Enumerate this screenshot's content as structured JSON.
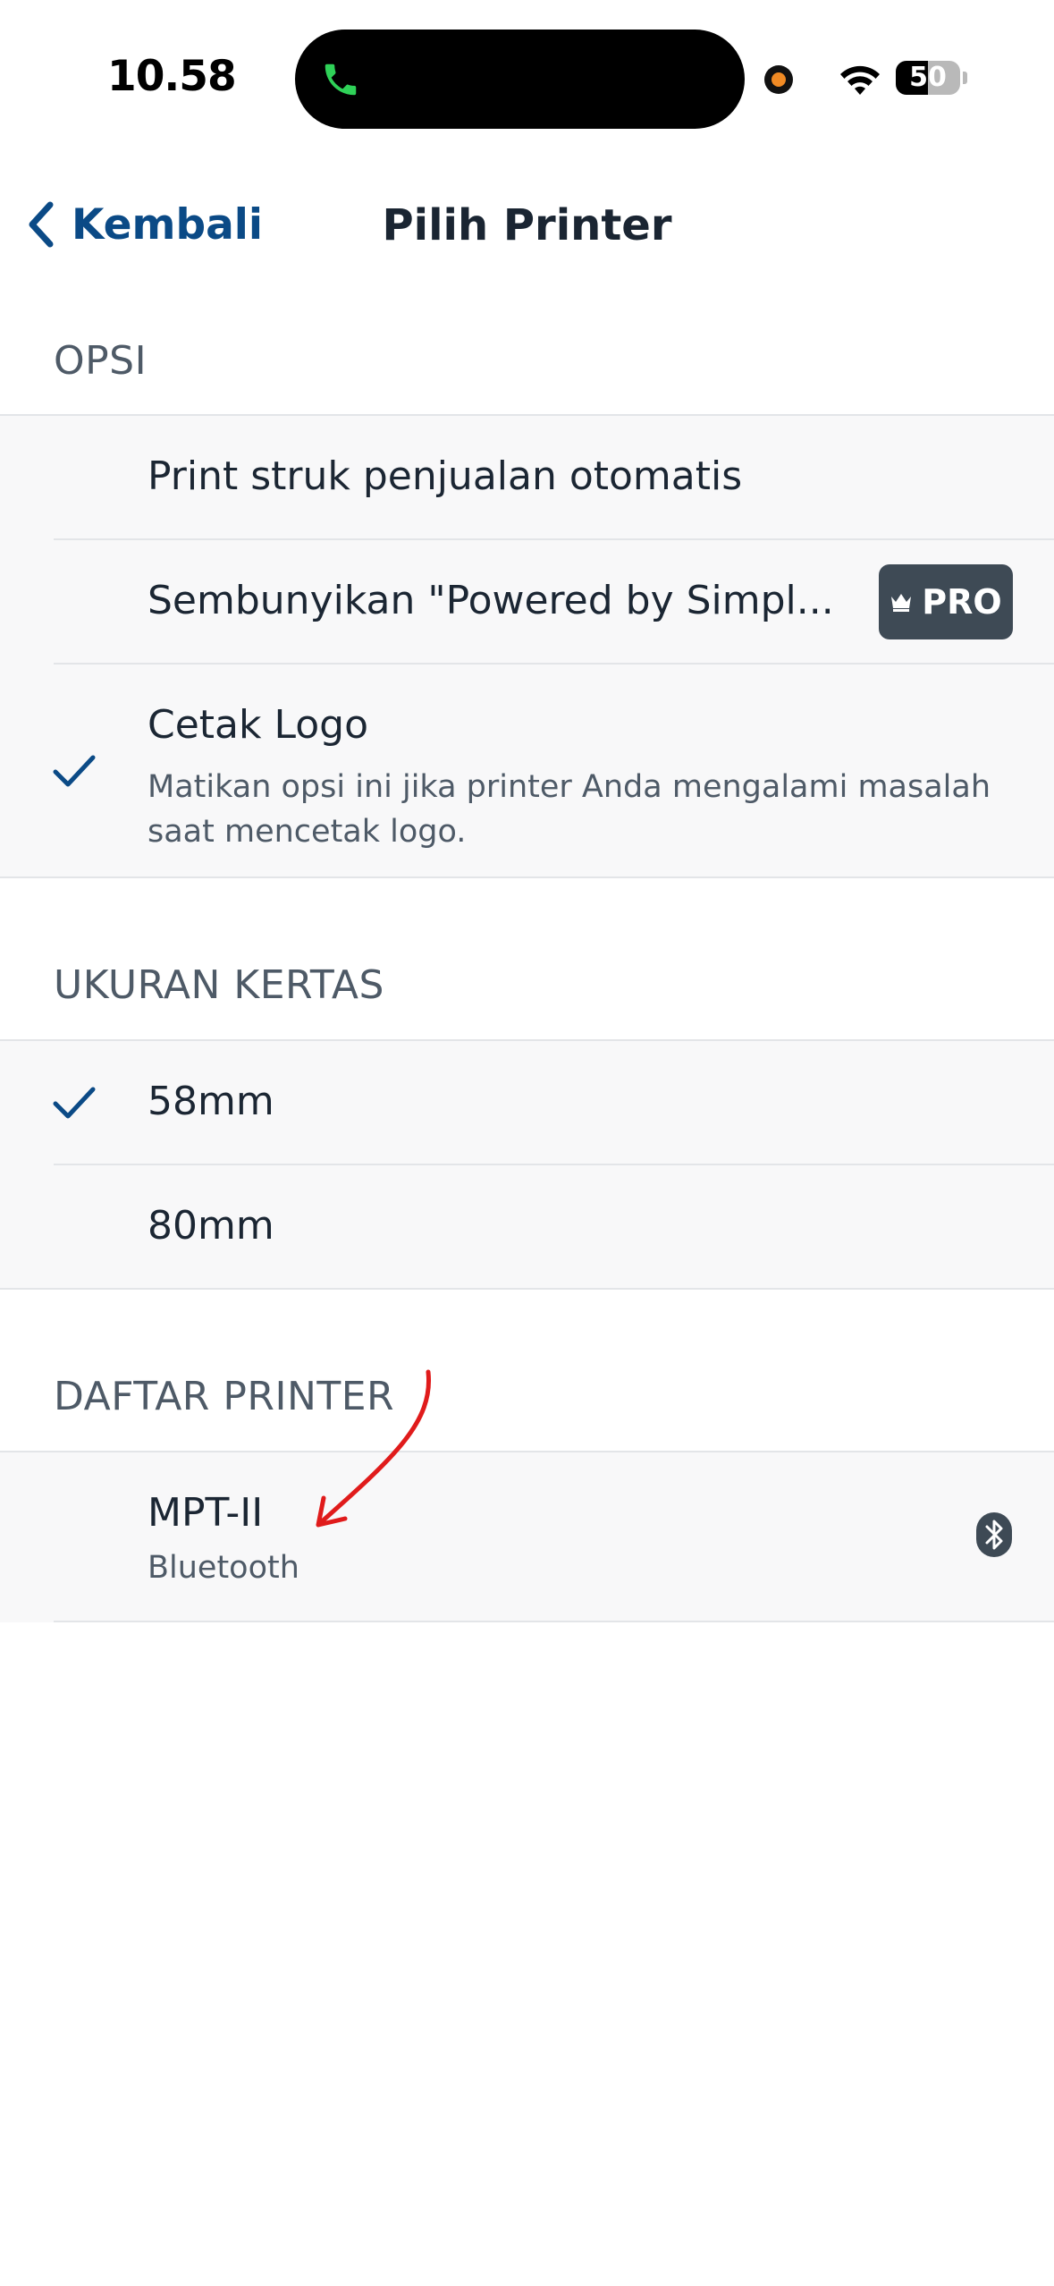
{
  "status_bar": {
    "time": "10.58",
    "battery_level": "50",
    "battery_fraction": 0.5,
    "icons": [
      "phone-icon",
      "recording-dot-icon",
      "wifi-icon",
      "battery-icon"
    ]
  },
  "nav": {
    "back_label": "Kembali",
    "title": "Pilih Printer"
  },
  "options_section": {
    "header": "OPSI",
    "items": [
      {
        "title": "Print struk penjualan otomatis",
        "checked": false
      },
      {
        "title": "Sembunyikan \"Powered by Simpl...",
        "checked": false,
        "badge": "PRO"
      },
      {
        "title": "Cetak Logo",
        "subtitle_line1": "Matikan opsi ini jika printer Anda mengalami masalah",
        "subtitle_line2": "saat mencetak logo.",
        "checked": true
      }
    ]
  },
  "paper_section": {
    "header": "UKURAN KERTAS",
    "items": [
      {
        "title": "58mm",
        "checked": true
      },
      {
        "title": "80mm",
        "checked": false
      }
    ]
  },
  "printers_section": {
    "header": "DAFTAR PRINTER",
    "items": [
      {
        "name": "MPT-II",
        "connection": "Bluetooth",
        "icon": "bluetooth-icon"
      }
    ]
  },
  "colors": {
    "accent": "#0b4a86",
    "annotation_arrow": "#e01b1b",
    "pro_badge": "#3e4a55"
  }
}
